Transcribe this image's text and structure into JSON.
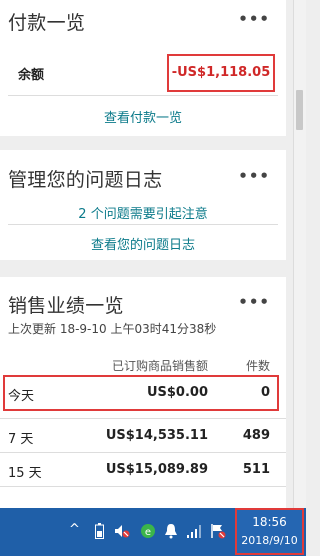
{
  "payments": {
    "title": "付款一览",
    "more": "•••",
    "balance_label": "余额",
    "balance_value": "-US$1,118.05",
    "view_link": "查看付款一览"
  },
  "cases": {
    "title": "管理您的问题日志",
    "more": "•••",
    "alert_link": "2 个问题需要引起注意",
    "view_link": "查看您的问题日志"
  },
  "sales": {
    "title": "销售业绩一览",
    "more": "•••",
    "updated": "上次更新 18-9-10 上午03时41分38秒",
    "col_sales": "已订购商品销售额",
    "col_count": "件数",
    "rows": [
      {
        "period": "今天",
        "amount": "US$0.00",
        "count": "0"
      },
      {
        "period": "7 天",
        "amount": "US$14,535.11",
        "count": "489"
      },
      {
        "period": "15 天",
        "amount": "US$15,089.89",
        "count": "511"
      }
    ]
  },
  "taskbar": {
    "tray_arrow": "^",
    "time": "18:56",
    "date": "2018/9/10",
    "icons": [
      "battery-icon",
      "volume-muted-icon",
      "green-app-icon",
      "bell-icon",
      "signal-icon",
      "flag-icon"
    ]
  }
}
